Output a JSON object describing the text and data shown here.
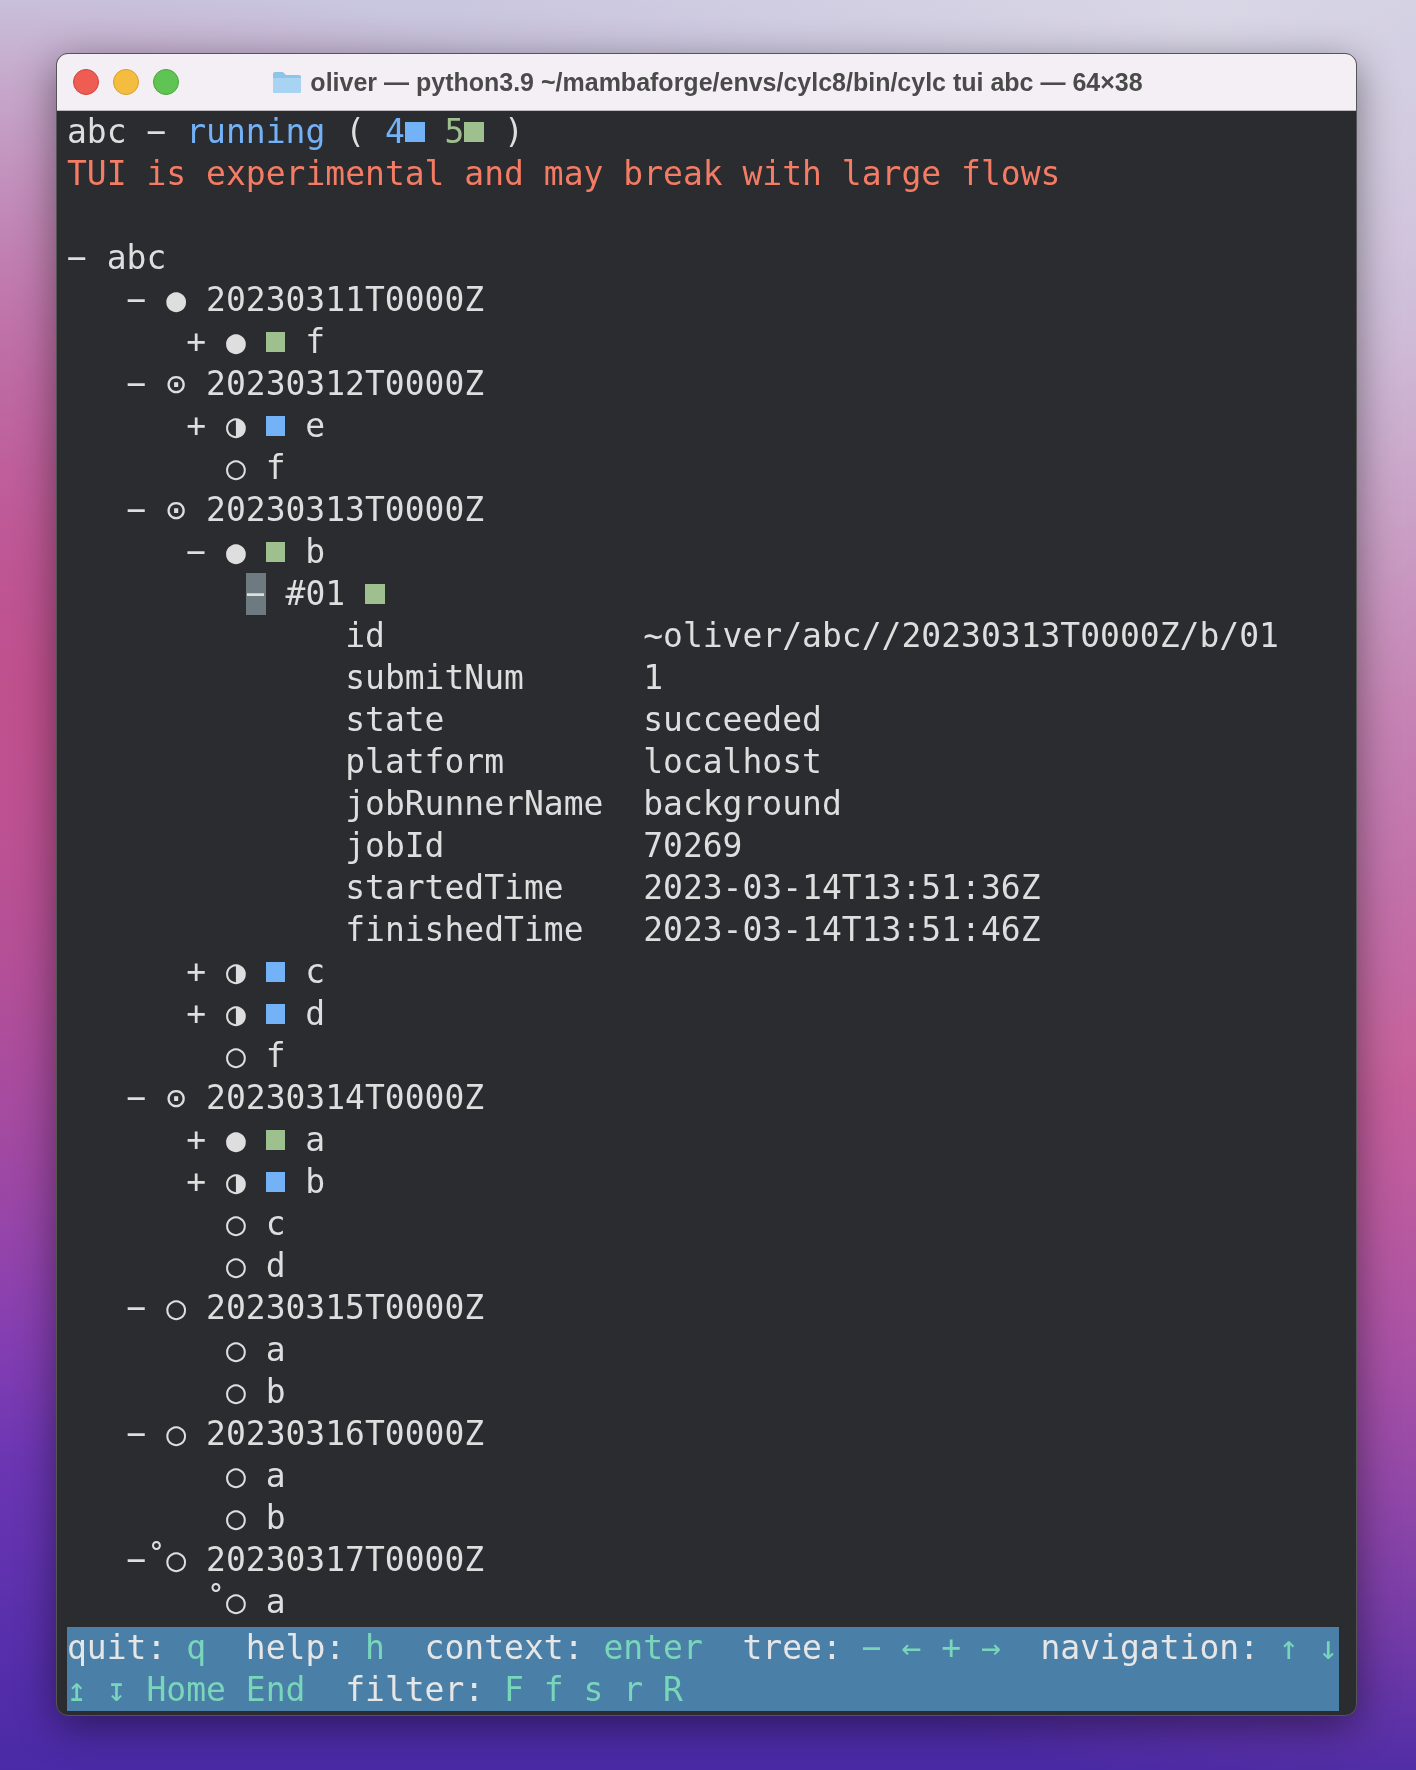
{
  "window": {
    "title": "oliver — python3.9 ~/mambaforge/envs/cylc8/bin/cylc tui abc — 64×38"
  },
  "status_line": {
    "workflow": "abc",
    "separator": "−",
    "status": "running",
    "open": "(",
    "counts": [
      {
        "count": "4",
        "color": "#74b2f8"
      },
      {
        "count": "5",
        "color": "#9ebf8e"
      }
    ],
    "close": ")"
  },
  "warning": "TUI is experimental and may break with large flows",
  "tree": [
    {
      "kind": "workflow",
      "toggle": "−",
      "label": "abc",
      "selected": false,
      "children": [
        {
          "kind": "cycle",
          "toggle": "−",
          "icon": "●",
          "label": "20230311T0000Z",
          "selected": false,
          "children": [
            {
              "kind": "task",
              "toggle": "+",
              "icon": "●",
              "color": "#9ebf8e",
              "label": "f",
              "selected": false
            }
          ]
        },
        {
          "kind": "cycle",
          "toggle": "−",
          "icon": "⊙",
          "label": "20230312T0000Z",
          "selected": false,
          "children": [
            {
              "kind": "task",
              "toggle": "+",
              "icon": "◑",
              "color": "#74b2f8",
              "label": "e",
              "selected": false
            },
            {
              "kind": "task",
              "icon": "○",
              "label": "f",
              "selected": false
            }
          ]
        },
        {
          "kind": "cycle",
          "toggle": "−",
          "icon": "⊙",
          "label": "20230313T0000Z",
          "selected": false,
          "children": [
            {
              "kind": "task",
              "toggle": "−",
              "icon": "●",
              "color": "#9ebf8e",
              "label": "b",
              "selected": false,
              "children": [
                {
                  "kind": "job",
                  "toggle": "−",
                  "label": "#01",
                  "color": "#9ebf8e",
                  "selected": true,
                  "details": [
                    {
                      "key": "id",
                      "value": "~oliver/abc//20230313T0000Z/b/01"
                    },
                    {
                      "key": "submitNum",
                      "value": "1"
                    },
                    {
                      "key": "state",
                      "value": "succeeded"
                    },
                    {
                      "key": "platform",
                      "value": "localhost"
                    },
                    {
                      "key": "jobRunnerName",
                      "value": "background"
                    },
                    {
                      "key": "jobId",
                      "value": "70269"
                    },
                    {
                      "key": "startedTime",
                      "value": "2023-03-14T13:51:36Z"
                    },
                    {
                      "key": "finishedTime",
                      "value": "2023-03-14T13:51:46Z"
                    }
                  ]
                }
              ]
            },
            {
              "kind": "task",
              "toggle": "+",
              "icon": "◑",
              "color": "#74b2f8",
              "label": "c",
              "selected": false
            },
            {
              "kind": "task",
              "toggle": "+",
              "icon": "◑",
              "color": "#74b2f8",
              "label": "d",
              "selected": false
            },
            {
              "kind": "task",
              "icon": "○",
              "label": "f",
              "selected": false
            }
          ]
        },
        {
          "kind": "cycle",
          "toggle": "−",
          "icon": "⊙",
          "label": "20230314T0000Z",
          "selected": false,
          "children": [
            {
              "kind": "task",
              "toggle": "+",
              "icon": "●",
              "color": "#9ebf8e",
              "label": "a",
              "selected": false
            },
            {
              "kind": "task",
              "toggle": "+",
              "icon": "◑",
              "color": "#74b2f8",
              "label": "b",
              "selected": false
            },
            {
              "kind": "task",
              "icon": "○",
              "label": "c",
              "selected": false
            },
            {
              "kind": "task",
              "icon": "○",
              "label": "d",
              "selected": false
            }
          ]
        },
        {
          "kind": "cycle",
          "toggle": "−",
          "icon": "○",
          "label": "20230315T0000Z",
          "selected": false,
          "children": [
            {
              "kind": "task",
              "icon": "○",
              "label": "a",
              "selected": false
            },
            {
              "kind": "task",
              "icon": "○",
              "label": "b",
              "selected": false
            }
          ]
        },
        {
          "kind": "cycle",
          "toggle": "−",
          "icon": "○",
          "label": "20230316T0000Z",
          "selected": false,
          "children": [
            {
              "kind": "task",
              "icon": "○",
              "label": "a",
              "selected": false
            },
            {
              "kind": "task",
              "icon": "○",
              "label": "b",
              "selected": false
            }
          ]
        },
        {
          "kind": "cycle",
          "toggle": "−",
          "prefix": "˚",
          "icon": "○",
          "label": "20230317T0000Z",
          "selected": false,
          "children": [
            {
              "kind": "task",
              "prefix": "˚",
              "icon": "○",
              "label": "a",
              "selected": false
            }
          ]
        }
      ]
    }
  ],
  "footer": [
    [
      {
        "label": "quit:",
        "keys": [
          "q"
        ]
      },
      {
        "label": "help:",
        "keys": [
          "h"
        ]
      },
      {
        "label": "context:",
        "keys": [
          "enter"
        ]
      },
      {
        "label": "tree:",
        "keys": [
          "−",
          "←",
          "+",
          "→"
        ]
      },
      {
        "label": "navigation:",
        "keys": [
          "↑",
          "↓"
        ]
      }
    ],
    [
      {
        "keys": [
          "↥",
          "↧",
          "Home",
          "End"
        ]
      },
      {
        "label": "filter:",
        "keys": [
          "F",
          "f",
          "s",
          "r",
          "R"
        ]
      }
    ]
  ]
}
